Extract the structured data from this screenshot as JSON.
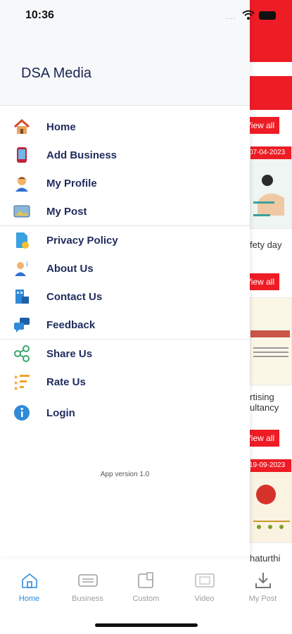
{
  "status": {
    "time": "10:36",
    "dots": "...."
  },
  "drawer": {
    "title": "DSA Media",
    "items": [
      {
        "label": "Home",
        "icon": "house-icon"
      },
      {
        "label": "Add Business",
        "icon": "phone-icon"
      },
      {
        "label": "My Profile",
        "icon": "person-icon"
      },
      {
        "label": "My Post",
        "icon": "photo-icon"
      },
      {
        "label": "Privacy Policy",
        "icon": "document-icon"
      },
      {
        "label": "About Us",
        "icon": "person-info-icon"
      },
      {
        "label": "Contact Us",
        "icon": "contact-building-icon"
      },
      {
        "label": "Feedback",
        "icon": "chat-bubbles-icon"
      },
      {
        "label": "Share Us",
        "icon": "share-icon"
      },
      {
        "label": "Rate Us",
        "icon": "rating-stars-icon"
      },
      {
        "label": "Login",
        "icon": "login-info-icon"
      }
    ],
    "version": "App version 1.0"
  },
  "background": {
    "view_all": "View all",
    "cards": [
      {
        "date": "07-04-2023",
        "caption": "fety day"
      },
      {
        "caption_1": "rtising",
        "caption_2": "ultancy"
      },
      {
        "date": "19-09-2023",
        "caption": "haturthi"
      }
    ]
  },
  "tabs": [
    {
      "label": "Home",
      "active": true
    },
    {
      "label": "Business",
      "active": false
    },
    {
      "label": "Custom",
      "active": false
    },
    {
      "label": "Video",
      "active": false
    },
    {
      "label": "My Post",
      "active": false
    }
  ],
  "colors": {
    "brand_red": "#ee1c24",
    "active_tab": "#2c8be0",
    "menu_text": "#1f2b5c"
  }
}
